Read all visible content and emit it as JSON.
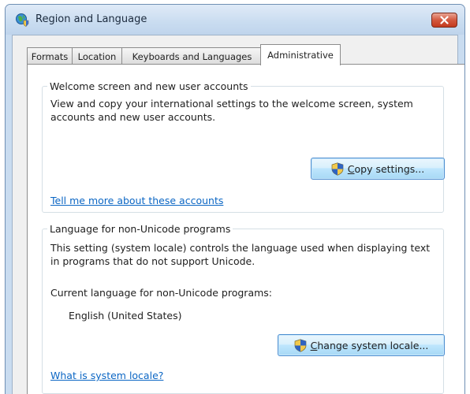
{
  "window": {
    "title": "Region and Language",
    "icon": "globe-shield-icon",
    "close_icon": "close-icon"
  },
  "tabs": [
    {
      "label": "Formats",
      "active": false
    },
    {
      "label": "Location",
      "active": false
    },
    {
      "label": "Keyboards and Languages",
      "active": false
    },
    {
      "label": "Administrative",
      "active": true
    }
  ],
  "welcome_group": {
    "legend": "Welcome screen and new user accounts",
    "description": "View and copy your international settings to the welcome screen, system accounts and new user accounts.",
    "button_mnemonic": "C",
    "button_rest": "opy settings...",
    "button_icon": "uac-shield-icon",
    "link": "Tell me more about these accounts"
  },
  "locale_group": {
    "legend": "Language for non-Unicode programs",
    "description": "This setting (system locale) controls the language used when displaying text in programs that do not support Unicode.",
    "current_label": "Current language for non-Unicode programs:",
    "current_value": "English (United States)",
    "button_mnemonic": "C",
    "button_rest": "hange system locale...",
    "button_icon": "uac-shield-icon",
    "link": "What is system locale?"
  },
  "colors": {
    "link": "#0b66c4",
    "close_button": "#c33a1e",
    "button_border": "#4f8fd0"
  }
}
